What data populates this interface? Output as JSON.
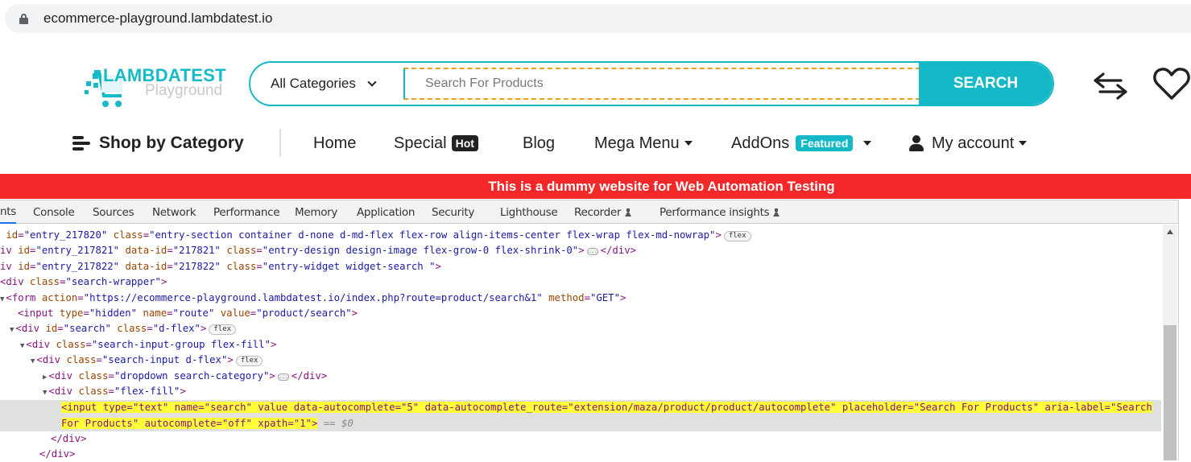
{
  "browser": {
    "url": "ecommerce-playground.lambdatest.io"
  },
  "header": {
    "logo_title": "LAMBDATEST",
    "logo_subtitle": "Playground",
    "category_select": "All Categories",
    "search_placeholder": "Search For Products",
    "search_button": "SEARCH",
    "brand_color": "#14b8c6"
  },
  "nav": {
    "shop_by_category": "Shop by Category",
    "items": [
      {
        "label": "Home"
      },
      {
        "label": "Special",
        "badge": "Hot"
      },
      {
        "label": "Blog"
      },
      {
        "label": "Mega Menu"
      },
      {
        "label": "AddOns",
        "badge": "Featured"
      },
      {
        "label": "My account"
      }
    ]
  },
  "banner": {
    "text": "This is a dummy website for Web Automation Testing",
    "color": "#f42828"
  },
  "devtools": {
    "tabs": [
      "nts",
      "Console",
      "Sources",
      "Network",
      "Performance",
      "Memory",
      "Application",
      "Security",
      "Lighthouse",
      "Recorder",
      "Performance insights"
    ],
    "active_tab": "Elements",
    "flex_badge": "flex",
    "selected_suffix": " == $0",
    "lines": [
      {
        "prefix": " ",
        "tag": "",
        "attrs": [
          [
            "id",
            "entry_217820"
          ],
          [
            "class",
            "entry-section container d-none d-md-flex flex-row align-items-center flex-wrap flex-md-nowrap"
          ]
        ],
        "close": ">",
        "badge": "flex"
      },
      {
        "prefix": "iv ",
        "attrs": [
          [
            "id",
            "entry_217821"
          ],
          [
            "data-id",
            "217821"
          ],
          [
            "class",
            "entry-design design-image flex-grow-0 flex-shrink-0"
          ]
        ],
        "close": ">",
        "ellipsis": true,
        "end": "</div>"
      },
      {
        "prefix": "iv ",
        "attrs": [
          [
            "id",
            "entry_217822"
          ],
          [
            "data-id",
            "217822"
          ],
          [
            "class",
            "entry-widget widget-search "
          ]
        ],
        "close": ">"
      },
      {
        "prefix": "<div ",
        "attrs": [
          [
            "class",
            "search-wrapper"
          ]
        ],
        "close": ">"
      },
      {
        "prefix": "<form ",
        "attrs": [
          [
            "action",
            "https://ecommerce-playground.lambdatest.io/index.php?route=product/search&1"
          ],
          [
            "method",
            "GET"
          ]
        ],
        "close": ">"
      },
      {
        "prefix": "<input ",
        "attrs": [
          [
            "type",
            "hidden"
          ],
          [
            "name",
            "route"
          ],
          [
            "value",
            "product/search"
          ]
        ],
        "close": ">"
      },
      {
        "prefix": "<div ",
        "attrs": [
          [
            "id",
            "search"
          ],
          [
            "class",
            "d-flex"
          ]
        ],
        "close": ">",
        "badge": "flex"
      },
      {
        "prefix": "<div ",
        "attrs": [
          [
            "class",
            "search-input-group flex-fill"
          ]
        ],
        "close": ">"
      },
      {
        "prefix": "<div ",
        "attrs": [
          [
            "class",
            "search-input d-flex"
          ]
        ],
        "close": ">",
        "badge": "flex"
      },
      {
        "prefix": "<div ",
        "attrs": [
          [
            "class",
            "dropdown search-category"
          ]
        ],
        "close": ">",
        "ellipsis": true,
        "end": "</div>"
      },
      {
        "prefix": "<div ",
        "attrs": [
          [
            "class",
            "flex-fill"
          ]
        ],
        "close": ">"
      }
    ],
    "selected_line_1": "<input type=\"text\" name=\"search\" value data-autocomplete=\"5\" data-autocomplete_route=\"extension/maza/product/product/autocomplete\" placeholder=\"Search For Products\" aria-label=\"Search",
    "selected_line_2": "For Products\" autocomplete=\"off\" xpath=\"1\">",
    "close_div_1": "</div>",
    "close_div_2": "</div>"
  }
}
